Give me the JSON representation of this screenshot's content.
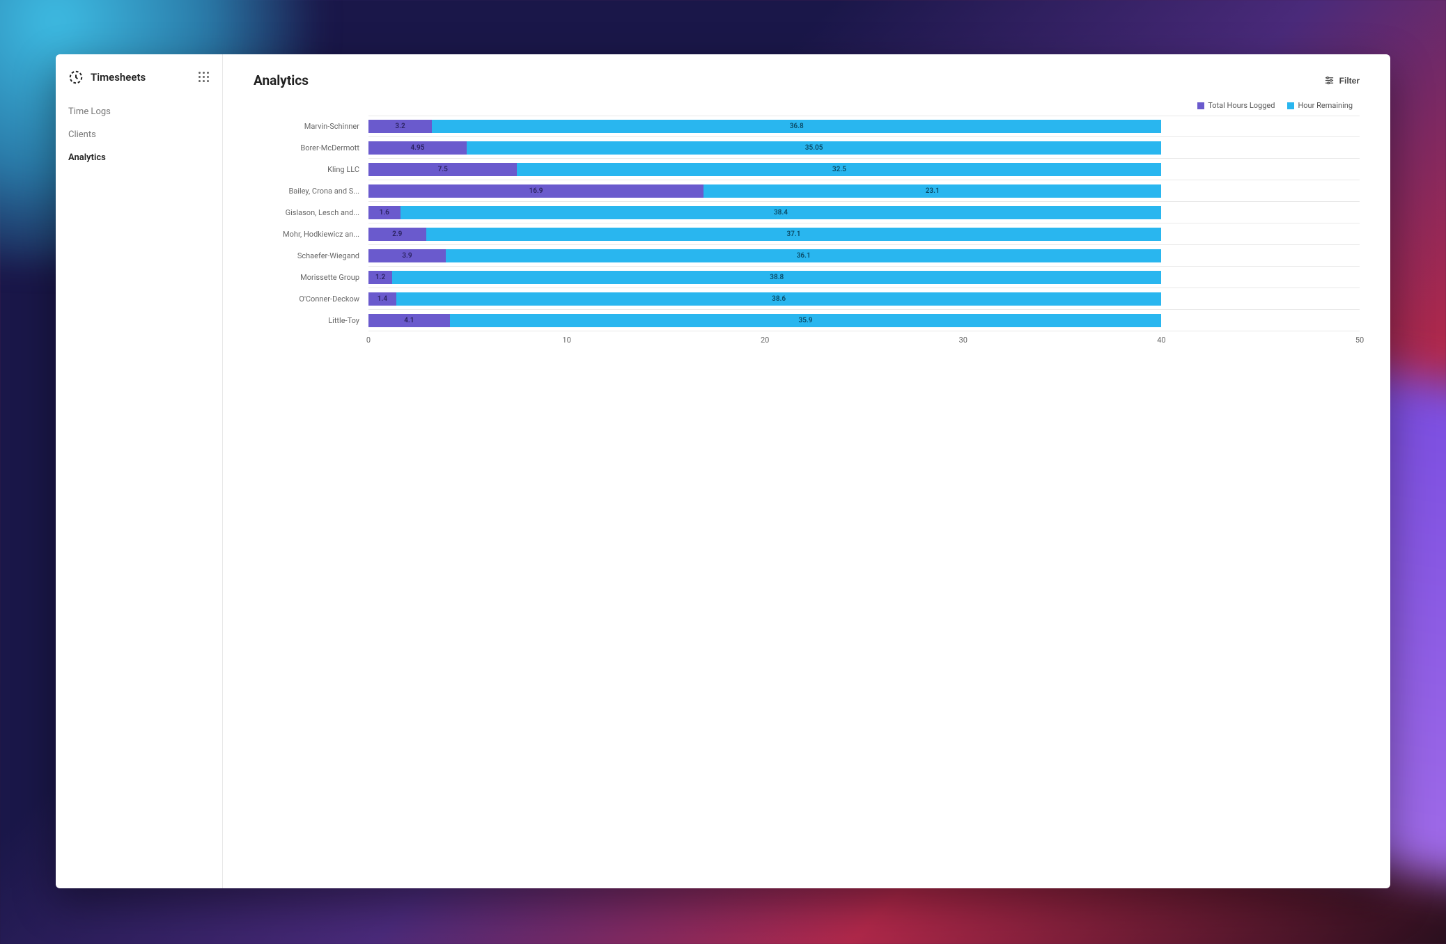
{
  "app": {
    "title": "Timesheets"
  },
  "sidebar": {
    "items": [
      {
        "label": "Time Logs",
        "active": false
      },
      {
        "label": "Clients",
        "active": false
      },
      {
        "label": "Analytics",
        "active": true
      }
    ]
  },
  "page": {
    "title": "Analytics",
    "filter_label": "Filter"
  },
  "legend": {
    "series1": "Total Hours Logged",
    "series2": "Hour Remaining"
  },
  "colors": {
    "logged": "#6a5acd",
    "remain": "#29b6ef"
  },
  "chart_data": {
    "type": "bar",
    "orientation": "horizontal",
    "stacked": true,
    "xlabel": "",
    "ylabel": "",
    "xlim": [
      0,
      50
    ],
    "x_ticks": [
      0,
      10,
      20,
      30,
      40,
      50
    ],
    "categories": [
      "Marvin-Schinner",
      "Borer-McDermott",
      "Kling LLC",
      "Bailey, Crona and S...",
      "Gislason, Lesch and...",
      "Mohr, Hodkiewicz an...",
      "Schaefer-Wiegand",
      "Morissette Group",
      "O'Conner-Deckow",
      "Little-Toy"
    ],
    "series": [
      {
        "name": "Total Hours Logged",
        "color": "#6a5acd",
        "values": [
          3.2,
          4.95,
          7.5,
          16.9,
          1.6,
          2.9,
          3.9,
          1.2,
          1.4,
          4.1
        ]
      },
      {
        "name": "Hour Remaining",
        "color": "#29b6ef",
        "values": [
          36.8,
          35.05,
          32.5,
          23.1,
          38.4,
          37.1,
          36.1,
          38.8,
          38.6,
          35.9
        ]
      }
    ]
  }
}
